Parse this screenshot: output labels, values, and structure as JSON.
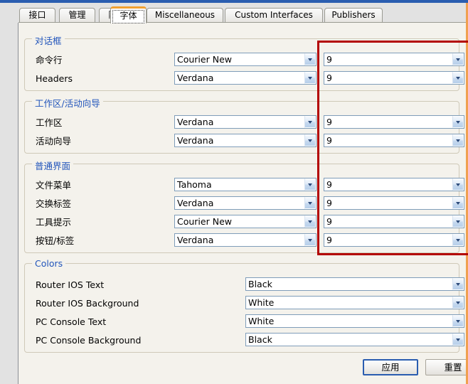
{
  "window": {
    "accent_blue": "#2a5db0",
    "accent_orange": "#f0a050",
    "annotation_red": "#b30000",
    "legend_blue": "#2255bb",
    "page_background": "#f4f2ec",
    "chrome_background": "#e2e2e2"
  },
  "tabs": [
    {
      "label": "接口",
      "active": false
    },
    {
      "label": "管理",
      "active": false
    },
    {
      "label": "隐藏",
      "active": false
    },
    {
      "label": "字体",
      "active": true
    },
    {
      "label": "Miscellaneous",
      "active": false
    },
    {
      "label": "Custom Interfaces",
      "active": false
    },
    {
      "label": "Publishers",
      "active": false
    }
  ],
  "groups": [
    {
      "legend": "对话框",
      "rows": [
        {
          "label": "命令行",
          "font": "Courier New",
          "size": "9"
        },
        {
          "label": "Headers",
          "font": "Verdana",
          "size": "9"
        }
      ]
    },
    {
      "legend": "工作区/活动向导",
      "rows": [
        {
          "label": "工作区",
          "font": "Verdana",
          "size": "9"
        },
        {
          "label": "活动向导",
          "font": "Verdana",
          "size": "9"
        }
      ]
    },
    {
      "legend": "普通界面",
      "rows": [
        {
          "label": "文件菜单",
          "font": "Tahoma",
          "size": "9"
        },
        {
          "label": "交换标签",
          "font": "Verdana",
          "size": "9"
        },
        {
          "label": "工具提示",
          "font": "Courier New",
          "size": "9"
        },
        {
          "label": "按钮/标签",
          "font": "Verdana",
          "size": "9"
        }
      ]
    }
  ],
  "colors_group": {
    "legend": "Colors",
    "rows": [
      {
        "label": "Router IOS Text",
        "value": "Black"
      },
      {
        "label": "Router IOS Background",
        "value": "White"
      },
      {
        "label": "PC Console Text",
        "value": "White"
      },
      {
        "label": "PC Console Background",
        "value": "Black"
      }
    ]
  },
  "buttons": {
    "apply": "应用",
    "reset": "重置"
  },
  "icons": {
    "dropdown": "chevron-down-icon"
  }
}
